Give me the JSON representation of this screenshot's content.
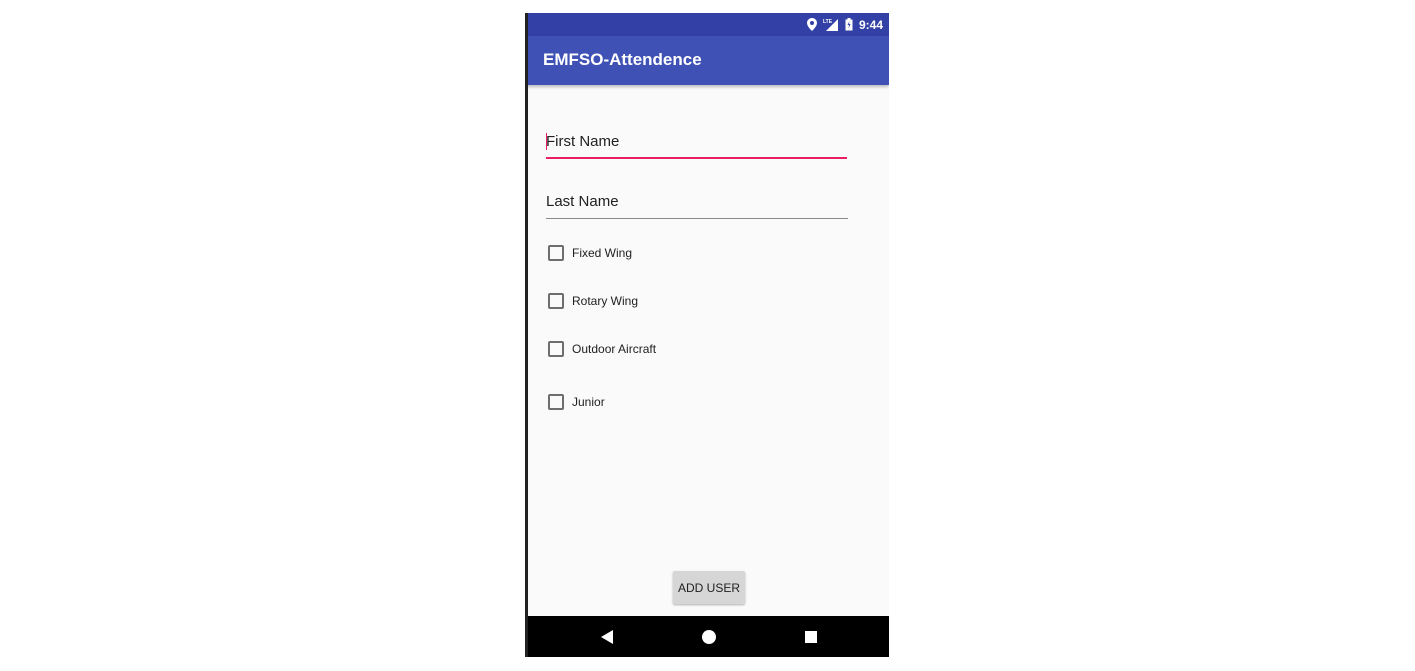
{
  "status_bar": {
    "time": "9:44",
    "icons": [
      "location-icon",
      "signal-icon",
      "battery-icon"
    ],
    "background": "#3341a6"
  },
  "app_bar": {
    "title": "EMFSO-Attendence",
    "background": "#3f51b5"
  },
  "form": {
    "first_name_placeholder": "First Name",
    "last_name_placeholder": "Last Name",
    "focused_field": "first_name",
    "accent_color": "#e91e63",
    "checkboxes": [
      {
        "label": "Fixed Wing",
        "checked": false
      },
      {
        "label": "Rotary Wing",
        "checked": false
      },
      {
        "label": "Outdoor Aircraft",
        "checked": false
      },
      {
        "label": "Junior",
        "checked": false
      }
    ],
    "add_button_label": "ADD USER"
  },
  "nav_bar": {
    "buttons": [
      "back-icon",
      "home-icon",
      "recents-icon"
    ]
  }
}
